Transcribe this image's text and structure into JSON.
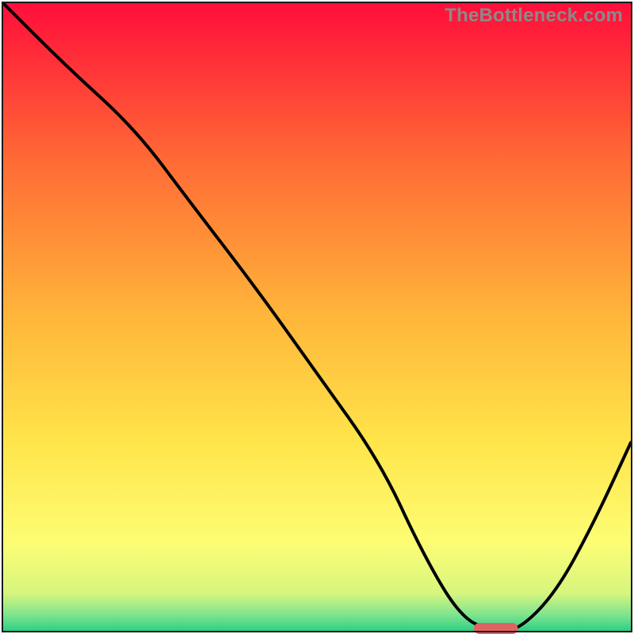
{
  "watermark": "TheBottleneck.com",
  "colors": {
    "curve": "#000000",
    "marker_fill": "#e06363",
    "border": "#1a1a1a"
  },
  "chart_data": {
    "type": "line",
    "title": "",
    "xlabel": "",
    "ylabel": "",
    "xlim": [
      0,
      100
    ],
    "ylim": [
      0,
      100
    ],
    "grid": false,
    "legend": false,
    "background_gradient_stops": [
      {
        "pos": 0.0,
        "color": "#ff0e3a"
      },
      {
        "pos": 0.25,
        "color": "#ff6a35"
      },
      {
        "pos": 0.5,
        "color": "#ffb63a"
      },
      {
        "pos": 0.7,
        "color": "#ffe54a"
      },
      {
        "pos": 0.86,
        "color": "#fdfd74"
      },
      {
        "pos": 0.94,
        "color": "#d7f57e"
      },
      {
        "pos": 0.975,
        "color": "#7de48e"
      },
      {
        "pos": 1.0,
        "color": "#2ecf86"
      }
    ],
    "series": [
      {
        "name": "bottleneck-curve",
        "x": [
          0,
          10,
          21,
          30,
          40,
          50,
          60,
          67,
          73,
          78,
          82,
          88,
          94,
          100
        ],
        "y": [
          100,
          90,
          80,
          68,
          55,
          41,
          27,
          12,
          2,
          0,
          0,
          6,
          17,
          30
        ]
      }
    ],
    "marker": {
      "name": "optimal-range",
      "x_start": 75,
      "x_end": 82,
      "y": 0
    }
  }
}
